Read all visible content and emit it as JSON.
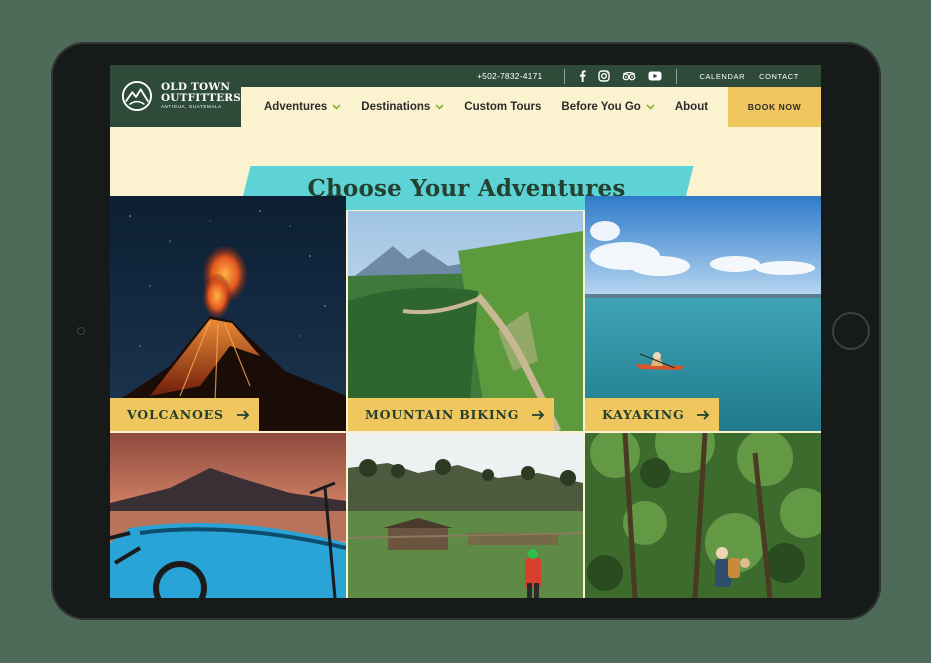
{
  "brand": {
    "name_line1": "OLD TOWN",
    "name_line2": "OUTFITTERS",
    "tagline": "ANTIGUA, GUATEMALA"
  },
  "utility": {
    "phone": "+502-7832-4171",
    "social_icons": [
      "facebook-icon",
      "instagram-icon",
      "tripadvisor-icon",
      "youtube-icon"
    ],
    "links": [
      "CALENDAR",
      "CONTACT"
    ]
  },
  "nav": {
    "items": [
      {
        "label": "Adventures",
        "dropdown": true
      },
      {
        "label": "Destinations",
        "dropdown": true
      },
      {
        "label": "Custom Tours",
        "dropdown": false
      },
      {
        "label": "Before You Go",
        "dropdown": true
      },
      {
        "label": "About",
        "dropdown": false
      }
    ],
    "cta": "BOOK NOW"
  },
  "page": {
    "title": "Choose Your Adventures"
  },
  "tiles": [
    {
      "label": "VOLCANOES"
    },
    {
      "label": "MOUNTAIN BIKING"
    },
    {
      "label": "KAYAKING"
    },
    {
      "label": ""
    },
    {
      "label": ""
    },
    {
      "label": ""
    }
  ],
  "colors": {
    "brand_green": "#2e4a38",
    "cream": "#fbf3cf",
    "accent_yellow": "#f0c75e",
    "accent_teal": "#5dd3d6"
  }
}
